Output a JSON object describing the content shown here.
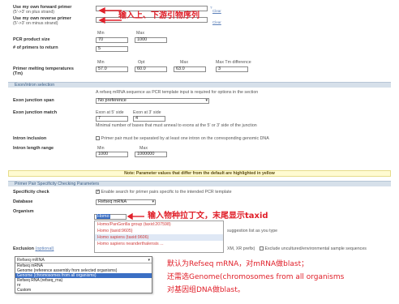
{
  "primers": {
    "forward_label": "Use my own forward primer",
    "forward_sub": "(5'->3' on plus strand)",
    "reverse_label": "Use my own reverse primer",
    "reverse_sub": "(5'->3' on minus strand)",
    "clear": "Clear",
    "annotation": "输入上、下游引物序列"
  },
  "product": {
    "min_header": "Min",
    "max_header": "Max",
    "size_label": "PCR product size",
    "size_min": "70",
    "size_max": "1000",
    "num_label": "# of primers to return",
    "num_value": "5"
  },
  "tm": {
    "label": "Primer melting temperatures",
    "label2": "(Tm)",
    "min_header": "Min",
    "opt_header": "Opt",
    "max_header": "Max",
    "diff_header": "Max Tm difference",
    "min": "57.0",
    "opt": "60.0",
    "max": "63.0",
    "diff": "3"
  },
  "exon": {
    "section_title": "Exon/intron selection",
    "section_note": "A refseq mRNA sequence as PCR template input is required for options in the section",
    "span_label": "Exon junction span",
    "span_value": "No preference",
    "match_label": "Exon junction match",
    "match_5": "Exon at 5' side",
    "match_3": "Exon at 3' side",
    "match_5_val": "7",
    "match_3_val": "4",
    "match_note": "Minimal number of bases that must anneal to exons at the 5' or 3' side of the junction",
    "intron_label": "Intron inclusion",
    "intron_note": "Primer pair must be separated by at least one intron on the corresponding genomic DNA",
    "range_label": "Intron length range",
    "range_min_header": "Min",
    "range_max_header": "Max",
    "range_min": "1000",
    "range_max": "1000000"
  },
  "note": "Note: Parameter values that differ from the default are highlighted in yellow",
  "specificity": {
    "section_title": "Primer Pair Specificity Checking Parameters",
    "check_label": "Specificity check",
    "check_note": "Enable search for primer pairs specific to the intended PCR template",
    "database_label": "Database",
    "database_value": "Refseq mRNA",
    "organism_label": "Organism",
    "organism_value": "Homo",
    "organism_annotation": "输入物种拉丁文，末尾显示taxid",
    "exclusion_label": "Exclusion",
    "exclusion_optional": "(optional)",
    "exclusion_tail": "XM, XR prefix)",
    "exclude_env": "Exclude uncultured/environmental sample sequences",
    "suggest_note": "suggestion list as you type"
  },
  "autocomplete": [
    "Homo/PanGorilla group (taxid:207598)",
    "Homo (taxid:9605)",
    "Homo sapiens (taxid:9606)",
    "Homo sapiens neanderthalensis ..."
  ],
  "db_dropdown": {
    "selected": "Refseq mRNA",
    "options": [
      "Refseq mRNA",
      "Genome (reference assembly from selected organisms)",
      "Genome (chromosomes from all organisms)",
      "Refseq RNA (refseq_rna)",
      "nr",
      "Custom"
    ],
    "highlighted_index": 2
  },
  "bottom_annotation": {
    "line1": "默认为Refseq mRNA，对mRNA做blast；",
    "line2": "还需选Genome(chromosomes from all organisms",
    "line3": "对基因组DNA做blast。"
  }
}
